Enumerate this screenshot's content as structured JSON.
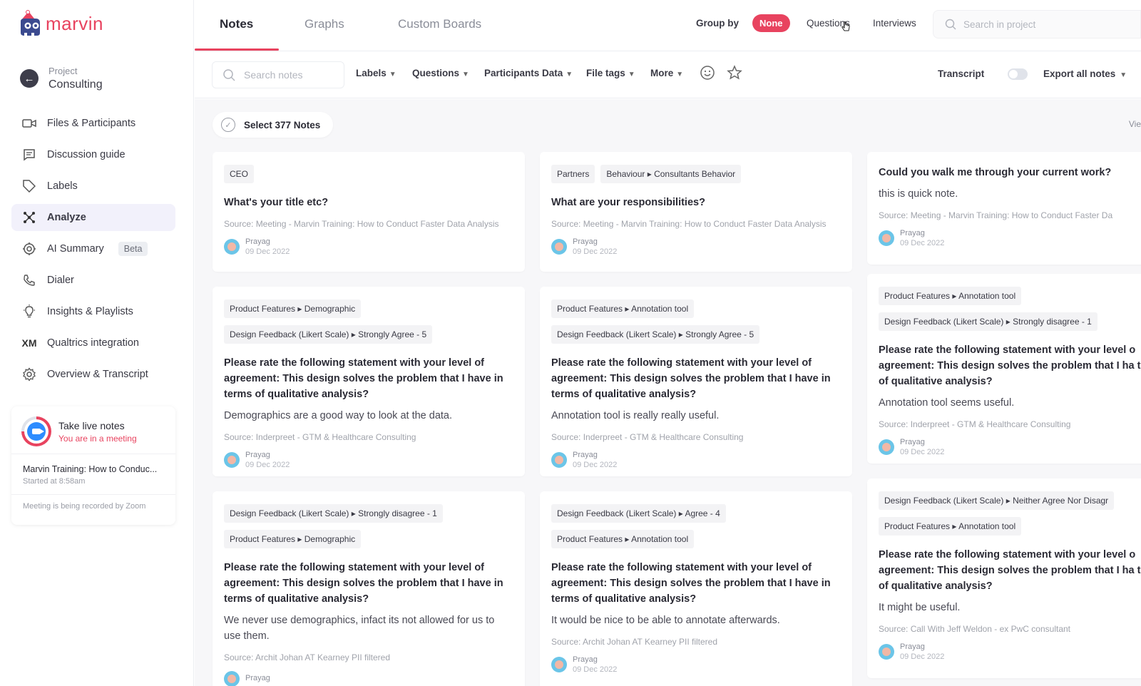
{
  "app": {
    "brand": "marvin",
    "brand_color": "#e8435f"
  },
  "sidebar": {
    "project_label": "Project",
    "project_name": "Consulting",
    "items": [
      {
        "label": "Files & Participants",
        "icon": "video-icon"
      },
      {
        "label": "Discussion guide",
        "icon": "chat-icon"
      },
      {
        "label": "Labels",
        "icon": "label-icon"
      },
      {
        "label": "Analyze",
        "icon": "analyze-icon",
        "active": true
      },
      {
        "label": "AI Summary",
        "icon": "ai-icon",
        "badge": "Beta"
      },
      {
        "label": "Dialer",
        "icon": "phone-icon"
      },
      {
        "label": "Insights & Playlists",
        "icon": "bulb-icon"
      },
      {
        "label": "Qualtrics integration",
        "icon": "xm-icon"
      },
      {
        "label": "Overview & Transcript",
        "icon": "gear-icon"
      }
    ],
    "live": {
      "title": "Take live notes",
      "subtitle": "You are in a meeting",
      "meeting": "Marvin Training: How to Conduc...",
      "started": "Started at 8:58am",
      "recorded": "Meeting is being recorded by Zoom"
    }
  },
  "topbar": {
    "tabs": [
      "Notes",
      "Graphs",
      "Custom Boards"
    ],
    "group_by_label": "Group by",
    "group_options": [
      "None",
      "Questions",
      "Interviews"
    ],
    "search_placeholder": "Search in project"
  },
  "filterbar": {
    "search_placeholder": "Search notes",
    "filters": [
      "Labels",
      "Questions",
      "Participants Data",
      "File tags",
      "More"
    ],
    "transcript_label": "Transcript",
    "export_label": "Export all notes"
  },
  "content": {
    "select_label": "Select 377 Notes",
    "view_label": "Vie"
  },
  "cards": [
    {
      "tags": [
        [
          "CEO"
        ]
      ],
      "question": "What's your title etc?",
      "answer": "",
      "source": "Source: Meeting - Marvin Training: How to Conduct Faster Data Analysis",
      "author": "Prayag",
      "date": "09 Dec 2022"
    },
    {
      "tags": [
        [
          "Partners",
          "Behaviour ▸ Consultants Behavior"
        ]
      ],
      "question": "What are your responsibilities?",
      "answer": "",
      "source": "Source: Meeting - Marvin Training: How to Conduct Faster Data Analysis",
      "author": "Prayag",
      "date": "09 Dec 2022"
    },
    {
      "tags": [],
      "question": "Could you walk me through your current work?",
      "answer": "this is quick note.",
      "source": "Source: Meeting - Marvin Training: How to Conduct Faster Da",
      "author": "Prayag",
      "date": "09 Dec 2022"
    },
    {
      "tags": [
        [
          "Product Features ▸ Demographic"
        ],
        [
          "Design Feedback (Likert Scale) ▸ Strongly Agree - 5"
        ]
      ],
      "question": "Please rate the following statement with your level of agreement: This design solves the problem that I have in terms of qualitative analysis?",
      "answer": "Demographics are a good way to look at the data.",
      "source": "Source: Inderpreet - GTM & Healthcare Consulting",
      "author": "Prayag",
      "date": "09 Dec 2022"
    },
    {
      "tags": [
        [
          "Product Features ▸ Annotation tool"
        ],
        [
          "Design Feedback (Likert Scale) ▸ Strongly Agree - 5"
        ]
      ],
      "question": "Please rate the following statement with your level of agreement: This design solves the problem that I have in terms of qualitative analysis?",
      "answer": "Annotation tool is really really useful.",
      "source": "Source: Inderpreet - GTM & Healthcare Consulting",
      "author": "Prayag",
      "date": "09 Dec 2022"
    },
    {
      "tags": [
        [
          "Product Features ▸ Annotation tool"
        ],
        [
          "Design Feedback (Likert Scale) ▸ Strongly disagree - 1"
        ]
      ],
      "question": "Please rate the following statement with your level o agreement: This design solves the problem that I ha terms of qualitative analysis?",
      "answer": "Annotation tool seems useful.",
      "source": "Source: Inderpreet - GTM & Healthcare Consulting",
      "author": "Prayag",
      "date": "09 Dec 2022"
    },
    {
      "tags": [
        [
          "Design Feedback (Likert Scale) ▸ Strongly disagree - 1"
        ],
        [
          "Product Features ▸ Demographic"
        ]
      ],
      "question": "Please rate the following statement with your level of agreement: This design solves the problem that I have in terms of qualitative analysis?",
      "answer": "We never use demographics, infact its not allowed for us to use them.",
      "source": "Source: Archit Johan AT Kearney PII filtered",
      "author": "Prayag",
      "date": ""
    },
    {
      "tags": [
        [
          "Design Feedback (Likert Scale) ▸ Agree - 4"
        ],
        [
          "Product Features ▸ Annotation tool"
        ]
      ],
      "question": "Please rate the following statement with your level of agreement: This design solves the problem that I have in terms of qualitative analysis?",
      "answer": "It would be nice to be able to annotate afterwards.",
      "source": "Source: Archit Johan AT Kearney PII filtered",
      "author": "Prayag",
      "date": "09 Dec 2022"
    },
    {
      "tags": [
        [
          "Design Feedback (Likert Scale) ▸ Neither Agree Nor Disagr"
        ],
        [
          "Product Features ▸ Annotation tool"
        ]
      ],
      "question": "Please rate the following statement with your level o agreement: This design solves the problem that I ha terms of qualitative analysis?",
      "answer": "It might be useful.",
      "source": "Source: Call With Jeff Weldon - ex PwC consultant",
      "author": "Prayag",
      "date": "09 Dec 2022"
    }
  ]
}
